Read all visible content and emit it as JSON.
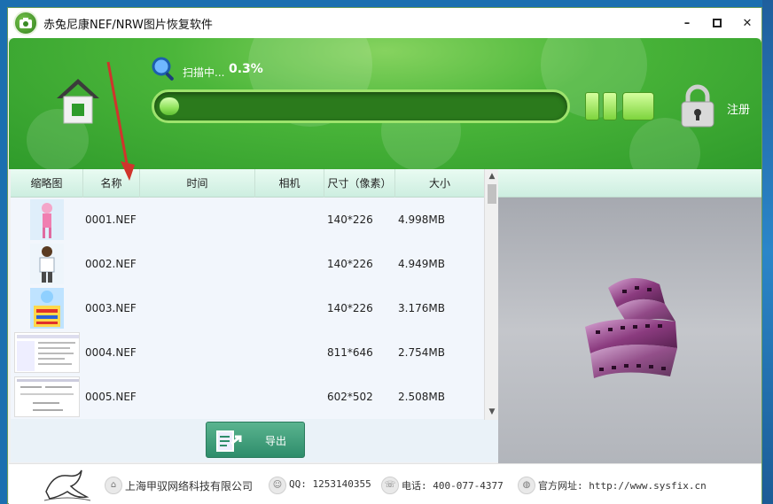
{
  "window": {
    "title": "赤兔尼康NEF/NRW图片恢复软件",
    "controls": {
      "minimize": "–",
      "maximize": "■",
      "close": "✕"
    }
  },
  "header": {
    "home_icon": "home-icon",
    "scan_label": "扫描中...",
    "scan_percent": "0.3%",
    "progress_fraction": 0.003,
    "pause_icon": "pause-icon",
    "stop_icon": "stop-icon",
    "lock_icon": "lock-icon",
    "register_label": "注册"
  },
  "table": {
    "columns": [
      "缩略图",
      "名称",
      "时间",
      "相机",
      "尺寸（像素）",
      "大小"
    ],
    "rows": [
      {
        "name": "0001.NEF",
        "time": "",
        "camera": "",
        "size_px": "140*226",
        "size": "4.998MB"
      },
      {
        "name": "0002.NEF",
        "time": "",
        "camera": "",
        "size_px": "140*226",
        "size": "4.949MB"
      },
      {
        "name": "0003.NEF",
        "time": "",
        "camera": "",
        "size_px": "140*226",
        "size": "3.176MB"
      },
      {
        "name": "0004.NEF",
        "time": "",
        "camera": "",
        "size_px": "811*646",
        "size": "2.754MB"
      },
      {
        "name": "0005.NEF",
        "time": "",
        "camera": "",
        "size_px": "602*502",
        "size": "2.508MB"
      }
    ]
  },
  "export": {
    "label": "导出"
  },
  "footer": {
    "company": "上海甲驭网络科技有限公司",
    "qq": "QQ: 1253140355",
    "phone": "电话: 400-077-4377",
    "website": "官方网址: http://www.sysfix.cn"
  },
  "colors": {
    "header_green": "#4bb63a",
    "progress_fill": "#8fe25a",
    "export_button": "#2e8d6b",
    "table_header": "#cdeee0",
    "annotation_arrow": "#d0342c"
  }
}
